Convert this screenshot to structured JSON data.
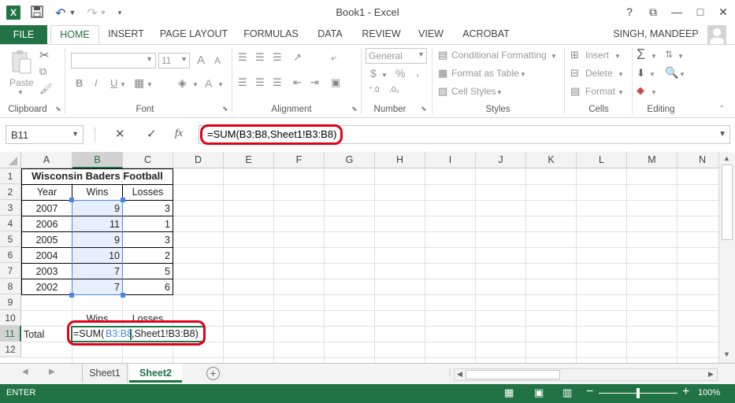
{
  "app": {
    "title": "Book1 - Excel",
    "help": "?",
    "win_min": "—",
    "win_max": "□",
    "win_close": "✕",
    "ribbon_opts": "⧉"
  },
  "tabs": [
    {
      "label": "FILE"
    },
    {
      "label": "HOME"
    },
    {
      "label": "INSERT"
    },
    {
      "label": "PAGE LAYOUT"
    },
    {
      "label": "FORMULAS"
    },
    {
      "label": "DATA"
    },
    {
      "label": "REVIEW"
    },
    {
      "label": "VIEW"
    },
    {
      "label": "ACROBAT"
    }
  ],
  "user": {
    "name": "SINGH, MANDEEP"
  },
  "ribbon": {
    "clipboard": {
      "label": "Clipboard",
      "paste": "Paste"
    },
    "font": {
      "label": "Font",
      "size": "11",
      "bold": "B",
      "italic": "I",
      "underline": "U",
      "grow": "A",
      "shrink": "A"
    },
    "alignment": {
      "label": "Alignment"
    },
    "number": {
      "label": "Number",
      "format": "General",
      "currency": "$",
      "percent": "%",
      "comma": ","
    },
    "styles": {
      "label": "Styles",
      "conditional": "Conditional Formatting",
      "table": "Format as Table",
      "cell_styles": "Cell Styles"
    },
    "cells": {
      "label": "Cells",
      "insert": "Insert",
      "delete": "Delete",
      "format": "Format"
    },
    "editing": {
      "label": "Editing",
      "sum": "Σ"
    }
  },
  "formula_bar": {
    "name_box": "B11",
    "cancel": "✕",
    "enter": "✓",
    "fx": "fx",
    "formula": "=SUM(B3:B8,Sheet1!B3:B8)"
  },
  "columns": [
    "A",
    "B",
    "C",
    "D",
    "E",
    "F",
    "G",
    "H",
    "I",
    "J",
    "K",
    "L",
    "M",
    "N"
  ],
  "rows": [
    "1",
    "2",
    "3",
    "4",
    "5",
    "6",
    "7",
    "8",
    "9",
    "10",
    "11",
    "12"
  ],
  "sheet": {
    "title": "Wisconsin Baders Football",
    "headers": {
      "year": "Year",
      "wins": "Wins",
      "losses": "Losses"
    },
    "data": [
      {
        "year": "2007",
        "wins": "9",
        "losses": "3"
      },
      {
        "year": "2006",
        "wins": "11",
        "losses": "1"
      },
      {
        "year": "2005",
        "wins": "9",
        "losses": "3"
      },
      {
        "year": "2004",
        "wins": "10",
        "losses": "2"
      },
      {
        "year": "2003",
        "wins": "7",
        "losses": "5"
      },
      {
        "year": "2002",
        "wins": "7",
        "losses": "6"
      }
    ],
    "row10": {
      "wins": "Wins",
      "losses": "Losses"
    },
    "total_label": "Total",
    "edit": {
      "prefix": "=SUM(",
      "ref": "B3:B8",
      "suffix": ",Sheet1!B3:B8)"
    }
  },
  "sheet_tabs": [
    {
      "label": "Sheet1"
    },
    {
      "label": "Sheet2"
    }
  ],
  "status": {
    "mode": "ENTER",
    "zoom": "100%"
  },
  "colors": {
    "excel_green": "#217346",
    "highlight_red": "#e0001a",
    "ref_blue": "#4a86e8"
  }
}
